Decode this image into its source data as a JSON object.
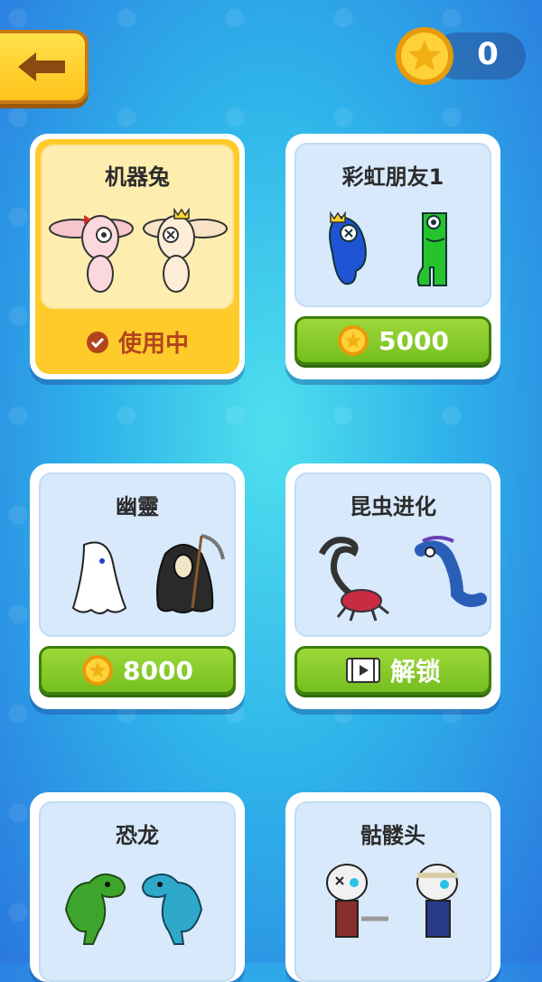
{
  "header": {
    "coins": "0"
  },
  "colors": {
    "accent": "#ffc21b",
    "button_green": "#7cc524",
    "status_text": "#b2451d"
  },
  "skins": [
    {
      "name": "机器兔",
      "status": "使用中",
      "selected": true
    },
    {
      "name": "彩虹朋友1",
      "price": "5000"
    },
    {
      "name": "幽靈",
      "price": "8000"
    },
    {
      "name": "昆虫进化",
      "unlock_label": "解锁"
    },
    {
      "name": "恐龙"
    },
    {
      "name": "骷髅头"
    }
  ]
}
